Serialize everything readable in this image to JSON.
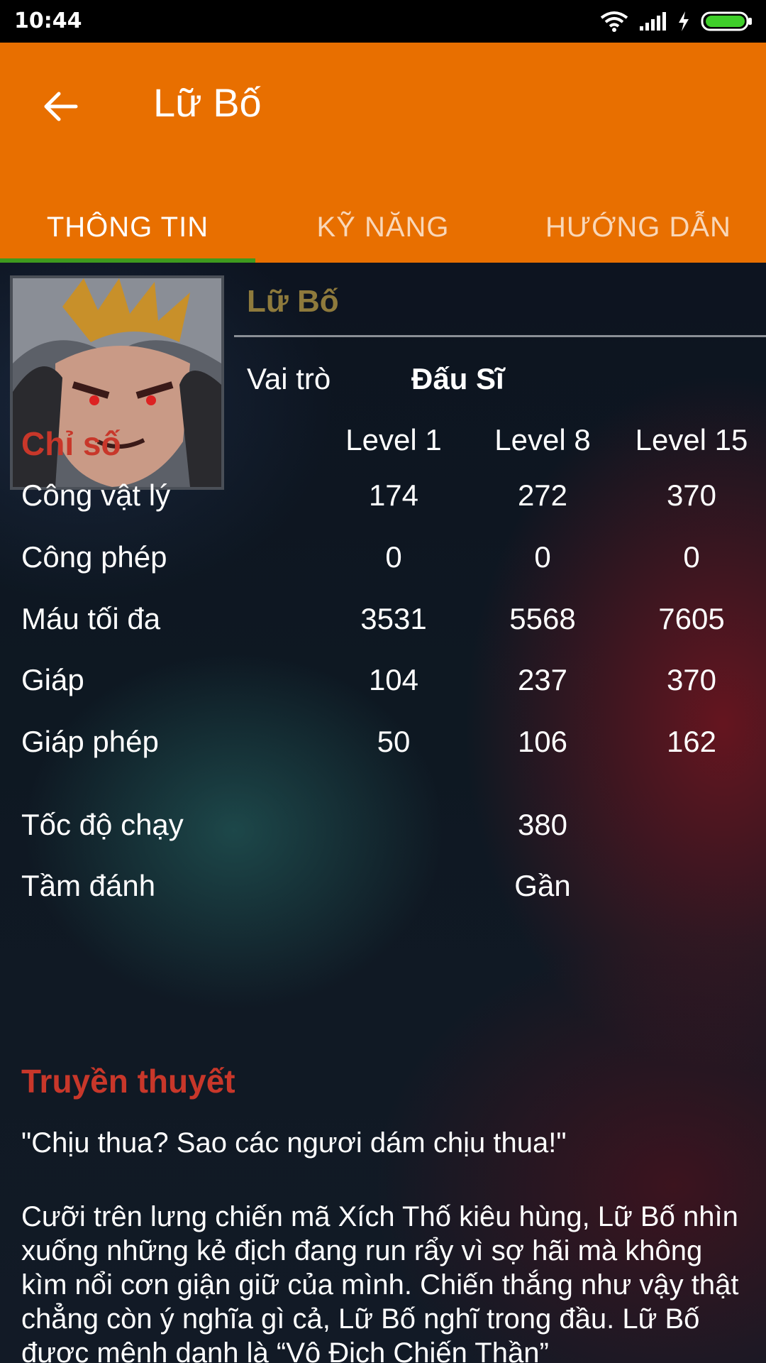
{
  "status_bar": {
    "time": "10:44"
  },
  "app_bar": {
    "title": "Lữ Bố"
  },
  "tabs": [
    {
      "label": "THÔNG TIN",
      "active": true
    },
    {
      "label": "KỸ NĂNG",
      "active": false
    },
    {
      "label": "HƯỚNG DẪN",
      "active": false
    }
  ],
  "hero": {
    "name": "Lữ Bố",
    "role_label": "Vai trò",
    "role_value": "Đấu Sĩ"
  },
  "stats": {
    "title": "Chỉ số",
    "levels": [
      "Level 1",
      "Level 8",
      "Level 15"
    ],
    "rows": [
      {
        "label": "Công vật lý",
        "values": [
          "174",
          "272",
          "370"
        ]
      },
      {
        "label": "Công phép",
        "values": [
          "0",
          "0",
          "0"
        ]
      },
      {
        "label": "Máu tối đa",
        "values": [
          "3531",
          "5568",
          "7605"
        ]
      },
      {
        "label": "Giáp",
        "values": [
          "104",
          "237",
          "370"
        ]
      },
      {
        "label": "Giáp phép",
        "values": [
          "50",
          "106",
          "162"
        ]
      }
    ],
    "movement_speed": {
      "label": "Tốc độ chạy",
      "value": "380"
    },
    "attack_range": {
      "label": "Tầm đánh",
      "value": "Gần"
    }
  },
  "legend": {
    "title": "Truyền thuyết",
    "quote": "\"Chịu thua? Sao các ngươi dám chịu thua!\"",
    "body": "Cưỡi trên lưng chiến mã Xích Thố kiêu hùng, Lữ Bố nhìn xuống những kẻ địch đang run rẩy vì sợ hãi mà không kìm nổi cơn giận giữ của mình. Chiến thắng như vậy thật chẳng còn ý nghĩa gì cả, Lữ Bố nghĩ trong đầu. Lữ Bố được mệnh danh là “Vô Địch Chiến Thần”"
  },
  "colors": {
    "app_bar": "#e86f00",
    "tab_indicator": "#3e9a1e",
    "section_title": "#c8372a",
    "hero_name": "#8e7a3c"
  }
}
